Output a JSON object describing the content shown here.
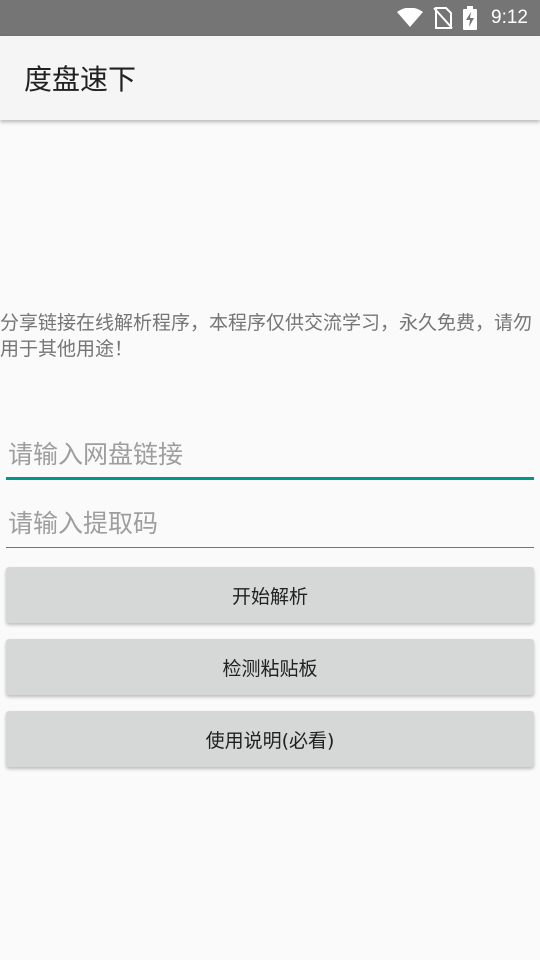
{
  "status_bar": {
    "time": "9:12",
    "icons": [
      "wifi-icon",
      "no-sim-icon",
      "battery-charging-icon"
    ]
  },
  "app_bar": {
    "title": "度盘速下"
  },
  "main": {
    "notice": "分享链接在线解析程序，本程序仅供交流学习，永久免费，请勿用于其他用途！",
    "link_input": {
      "value": "",
      "placeholder": "请输入网盘链接"
    },
    "code_input": {
      "value": "",
      "placeholder": "请输入提取码"
    },
    "buttons": {
      "parse": "开始解析",
      "clipboard": "检测粘贴板",
      "help": "使用说明(必看)"
    }
  },
  "colors": {
    "status_bar": "#757575",
    "app_bar": "#f5f5f5",
    "accent": "#009688",
    "button": "#d6d7d7",
    "background": "#fafafa"
  }
}
